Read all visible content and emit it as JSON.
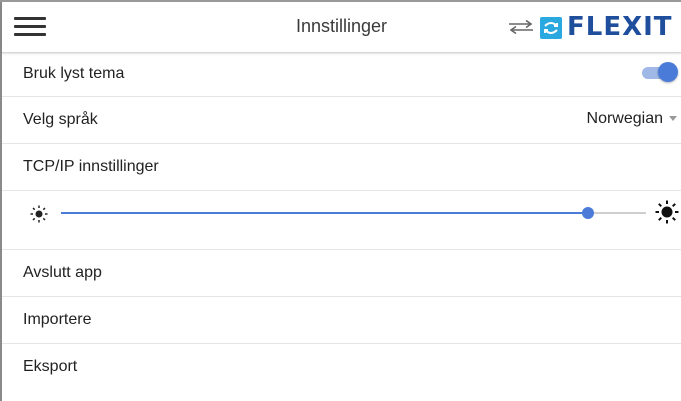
{
  "app": {
    "title": "Innstillinger",
    "logo_text": "FLEXIT"
  },
  "settings": {
    "light_theme": {
      "label": "Bruk lyst tema",
      "enabled": true
    },
    "language": {
      "label": "Velg språk",
      "value": "Norwegian"
    },
    "tcpip": {
      "label": "TCP/IP innstillinger"
    },
    "brightness": {
      "level_fraction": 0.9
    },
    "exit": {
      "label": "Avslutt app"
    },
    "import": {
      "label": "Importere"
    },
    "export": {
      "label": "Eksport"
    }
  },
  "colors": {
    "accent": "#4a7bd8",
    "brand_blue": "#1f4e9c",
    "brand_cyan": "#2aa8e0"
  },
  "icons": {
    "menu": "hamburger-menu-icon",
    "sync": "sync-arrows-icon",
    "brightness_low": "sun-small-icon",
    "brightness_high": "sun-large-icon"
  }
}
